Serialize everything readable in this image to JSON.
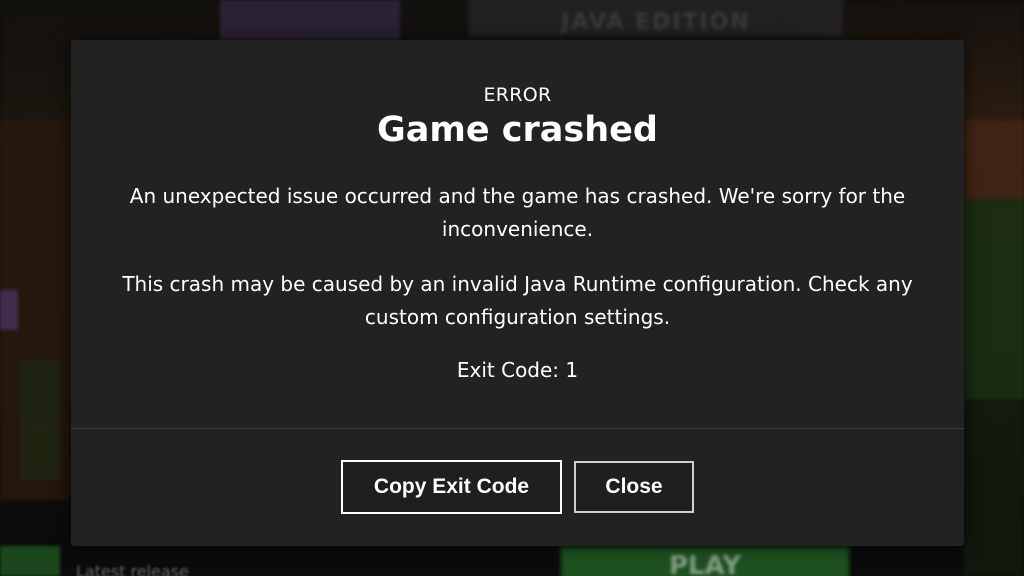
{
  "background": {
    "logo_subtitle": "JAVA EDITION",
    "play_label": "PLAY",
    "release_label": "Latest release"
  },
  "dialog": {
    "eyebrow": "ERROR",
    "title": "Game crashed",
    "message_1": "An unexpected issue occurred and the game has crashed. We're sorry for the inconvenience.",
    "message_2": "This crash may be caused by an invalid Java Runtime configuration. Check any custom configuration settings.",
    "exit_code": "Exit Code: 1",
    "buttons": {
      "copy_exit_code": "Copy Exit Code",
      "close": "Close"
    }
  },
  "colors": {
    "dialog_background": "#222222",
    "text": "#ffffff",
    "button_border": "#ffffff"
  }
}
